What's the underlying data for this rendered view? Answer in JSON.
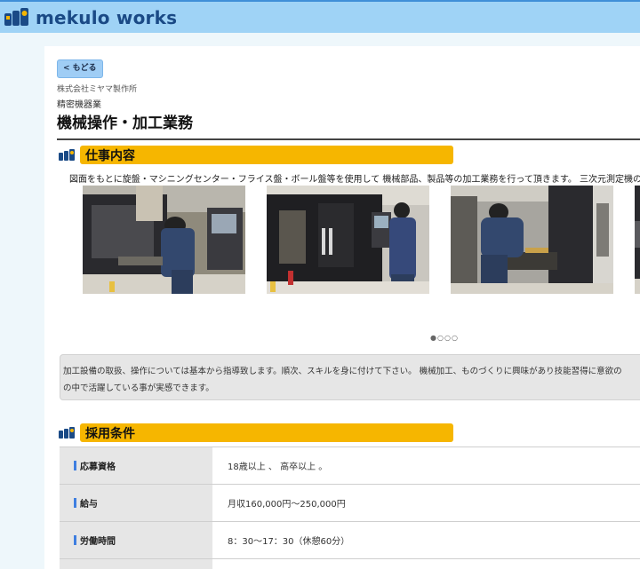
{
  "brand": {
    "name": "mekulo works"
  },
  "nav": {
    "back_label": "< もどる"
  },
  "job": {
    "company": "株式会社ミヤマ製作所",
    "industry": "精密機器業",
    "title": "機械操作・加工業務"
  },
  "sections": {
    "work": {
      "title": "仕事内容",
      "description": "図面をもとに旋盤・マシニングセンター・フライス盤・ボール盤等を使用して 機械部品、製品等の加工業務を行って頂きます。 三次元測定機の作",
      "carousel_dots": "●○○○",
      "note_lines": [
        "加工設備の取扱、操作については基本から指導致します。順次、スキルを身に付けて下さい。 機械加工、ものづくりに興味があり技能習得に意欲の",
        "の中で活躍している事が実感できます。"
      ]
    },
    "conditions": {
      "title": "採用条件",
      "rows": [
        {
          "label": "応募資格",
          "value": "18歳以上 、 高卒以上 。"
        },
        {
          "label": "給与",
          "value": "月収160,000円〜250,000円"
        },
        {
          "label": "労働時間",
          "value": "8：30〜17：30（休憩60分）"
        },
        {
          "label": "",
          "value": ""
        }
      ]
    }
  },
  "colors": {
    "header_bg": "#9fd3f6",
    "brand_text": "#1a4a86",
    "section_bar": "#f6b600",
    "label_mark": "#3f7fe0"
  }
}
